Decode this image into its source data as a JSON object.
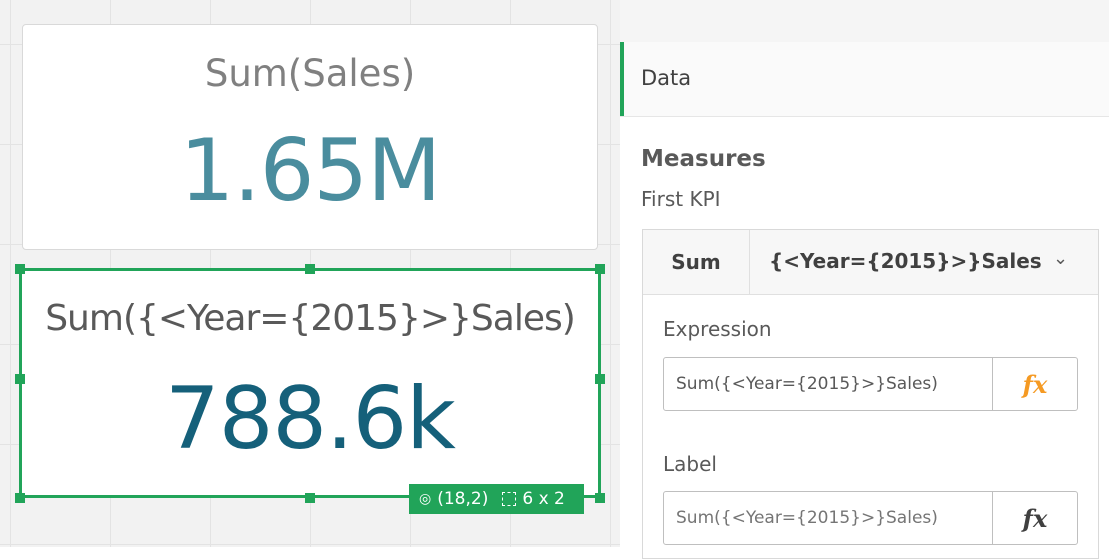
{
  "kpi_primary": {
    "title": "Sum(Sales)",
    "value": "1.65M",
    "value_color": "#4a8d9e"
  },
  "kpi_selected": {
    "title": "Sum({<Year={2015}>}Sales)",
    "value": "788.6k",
    "value_color": "#15607a",
    "selection_color": "#21a459",
    "position_badge": "(18,2)",
    "size_badge": "6 x 2"
  },
  "panel": {
    "section": "Data",
    "measures_title": "Measures",
    "object_name": "First KPI",
    "measure": {
      "aggregation": "Sum",
      "expression_header": "{<Year={2015}>}Sales",
      "expression_label": "Expression",
      "expression_value": "Sum({<Year={2015}>}Sales)",
      "label_label": "Label",
      "label_placeholder": "Sum({<Year={2015}>}Sales)",
      "fx": "fx"
    }
  },
  "icons": {
    "position": "target-icon",
    "size": "grid-size-icon",
    "dropdown": "chevron-down-icon",
    "expression_editor": "fx-icon"
  }
}
